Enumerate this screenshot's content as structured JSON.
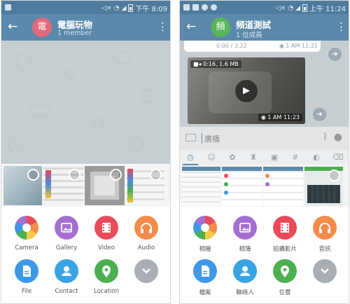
{
  "left": {
    "status": {
      "time": "下午 8:09"
    },
    "header": {
      "back": "←",
      "avatar_letter": "電",
      "title": "電腦玩物",
      "subtitle": "1 member",
      "menu": "⋮"
    },
    "attach": [
      {
        "label": "Camera"
      },
      {
        "label": "Gallery"
      },
      {
        "label": "Video"
      },
      {
        "label": "Audio"
      },
      {
        "label": "File"
      },
      {
        "label": "Contact"
      },
      {
        "label": "Location"
      },
      {
        "label": ""
      }
    ]
  },
  "right": {
    "status": {
      "time": "上午 11:24"
    },
    "header": {
      "back": "←",
      "avatar_letter": "頻",
      "title": "頻道測試",
      "subtitle": "1 位成員",
      "menu": "⋮"
    },
    "messages": {
      "audio_time": "0:00 / 3:22",
      "audio_meta": "1  AM 11:21",
      "video_tag": "0:16, 1.6 MB",
      "video_meta": "1  AM 11:23"
    },
    "composer": {
      "hint": "廣播"
    },
    "attach": [
      {
        "label": "相機"
      },
      {
        "label": "相簿"
      },
      {
        "label": "拍攝影片"
      },
      {
        "label": "音訊"
      },
      {
        "label": "檔案"
      },
      {
        "label": "聯絡人"
      },
      {
        "label": "位置"
      },
      {
        "label": ""
      }
    ]
  },
  "colors": {
    "appbar": "#5b89ab",
    "camera": "rainbow",
    "gallery": "#a56fd1",
    "video": "#e94b5a",
    "audio": "#f58b4a",
    "file": "#3f98e7",
    "contact": "#39a3e4",
    "location": "#4cb051",
    "more": "#a8aeb4"
  },
  "icons": [
    "camera-icon",
    "gallery-icon",
    "video-icon",
    "headphones-icon",
    "file-icon",
    "contact-icon",
    "location-icon",
    "chevron-down-icon"
  ]
}
